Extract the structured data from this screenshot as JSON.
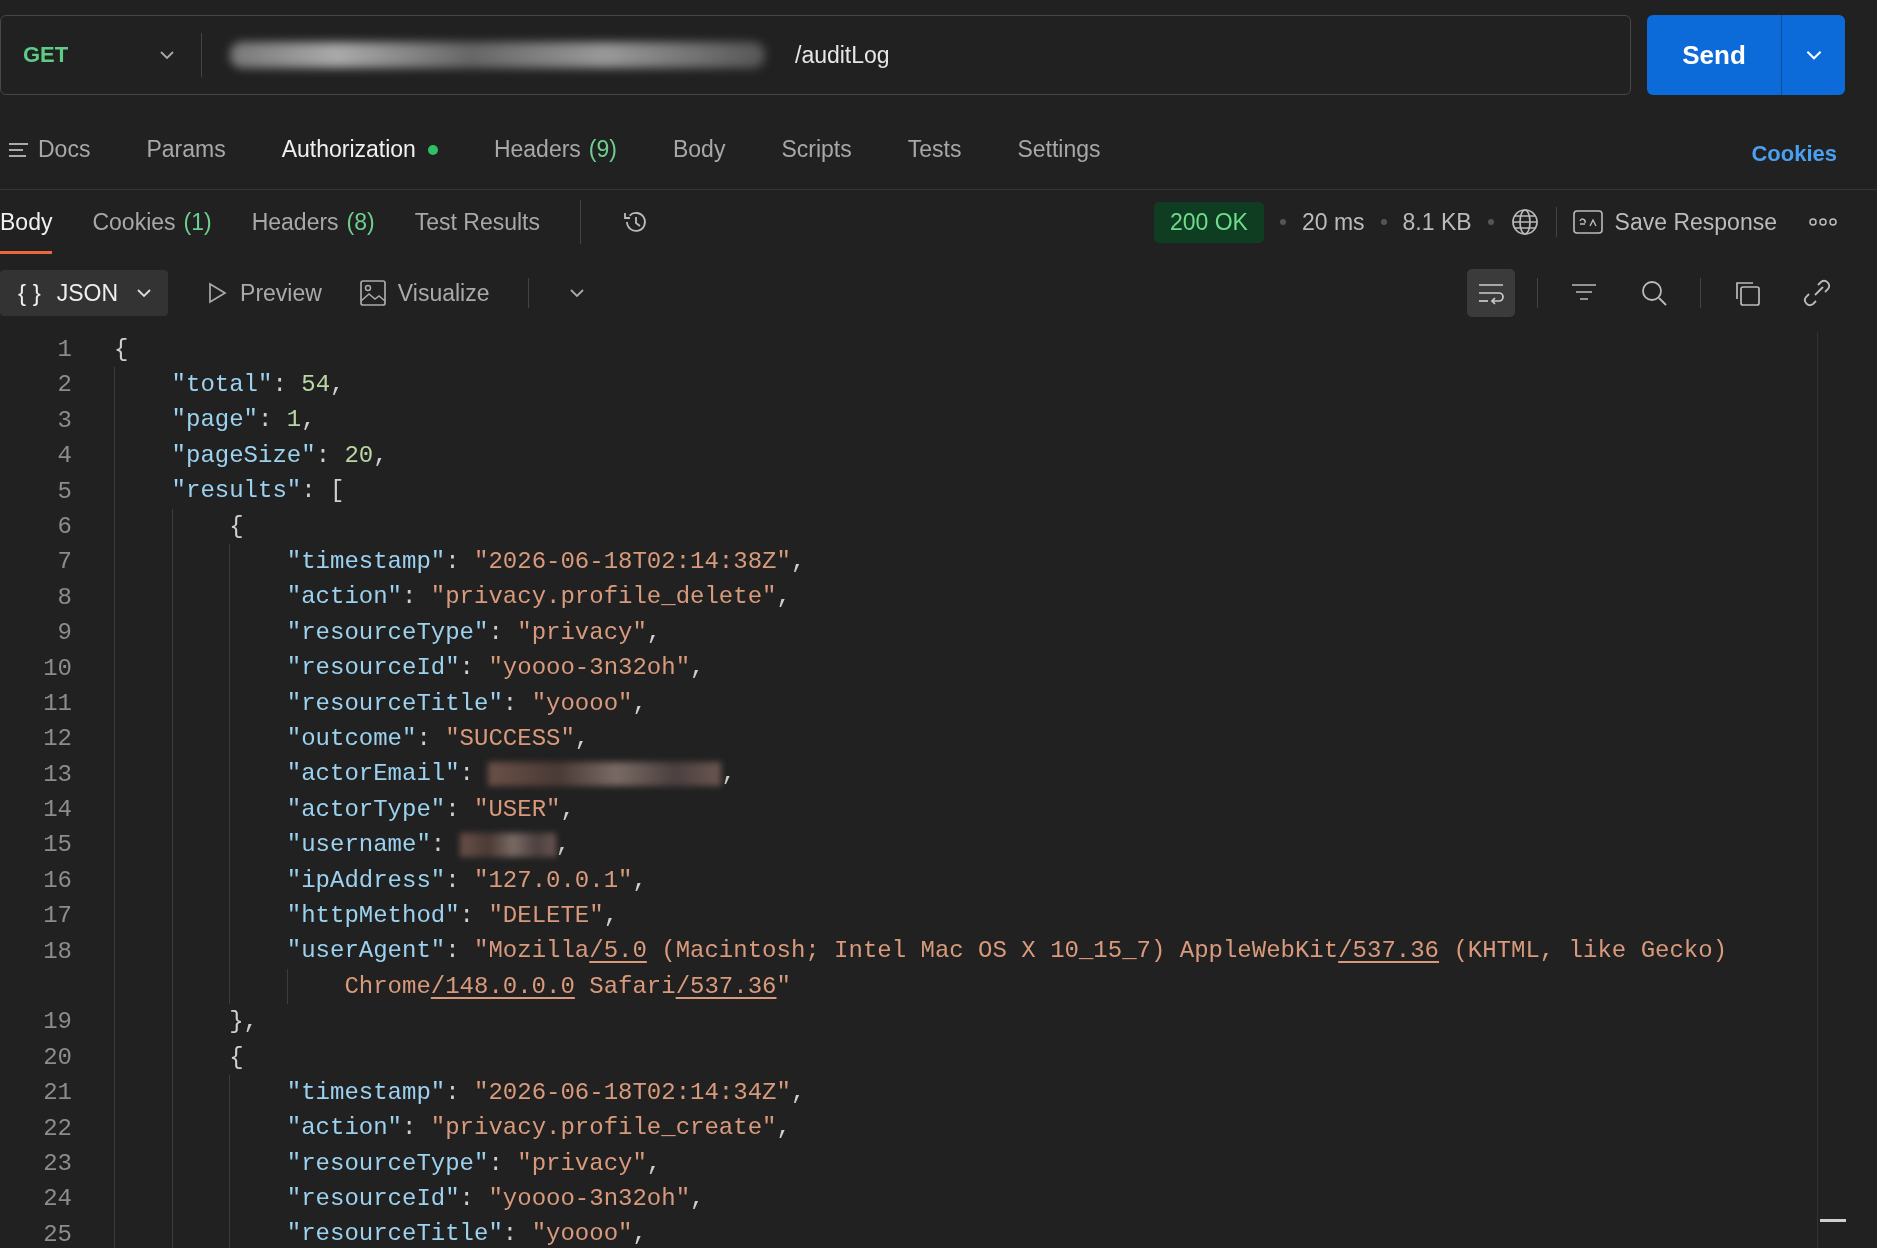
{
  "request": {
    "method": "GET",
    "url": {
      "redacted": true,
      "path": "/auditLog"
    },
    "send": "Send"
  },
  "request_tabs": [
    {
      "label": "Docs",
      "kind": "docs",
      "selected": false
    },
    {
      "label": "Params",
      "selected": false
    },
    {
      "label": "Authorization",
      "dot": true,
      "selected": true
    },
    {
      "label": "Headers",
      "count": "(9)",
      "selected": false
    },
    {
      "label": "Body",
      "selected": false
    },
    {
      "label": "Scripts",
      "selected": false
    },
    {
      "label": "Tests",
      "selected": false
    },
    {
      "label": "Settings",
      "selected": false
    }
  ],
  "cookies_link": "Cookies",
  "response": {
    "tabs": [
      {
        "label": "Body",
        "selected": true
      },
      {
        "label": "Cookies",
        "count": "(1)",
        "selected": false
      },
      {
        "label": "Headers",
        "count": "(8)",
        "selected": false
      },
      {
        "label": "Test Results",
        "selected": false
      }
    ],
    "status": "200 OK",
    "time": "20 ms",
    "size": "8.1 KB",
    "save_label": "Save Response",
    "format": {
      "glyph": "{ }",
      "label": "JSON"
    },
    "views": [
      {
        "label": "Preview",
        "kind": "preview"
      },
      {
        "label": "Visualize",
        "kind": "visualize"
      }
    ],
    "tools": [
      {
        "kind": "wrap",
        "selected": true
      },
      {
        "kind": "divider"
      },
      {
        "kind": "filter",
        "selected": false
      },
      {
        "kind": "search",
        "selected": false
      },
      {
        "kind": "divider"
      },
      {
        "kind": "copy",
        "selected": false
      },
      {
        "kind": "link",
        "selected": false
      }
    ],
    "lines": [
      {
        "n": "1",
        "tokens": [
          {
            "kind": "open",
            "text": "{"
          }
        ]
      },
      {
        "n": "2",
        "tokens": [
          {
            "kind": "key",
            "text": "\"total\""
          },
          {
            "kind": "punct",
            "text": ": "
          },
          {
            "kind": "number",
            "text": "54"
          },
          {
            "kind": "punct",
            "text": ","
          }
        ]
      },
      {
        "n": "3",
        "tokens": [
          {
            "kind": "key",
            "text": "\"page\""
          },
          {
            "kind": "punct",
            "text": ": "
          },
          {
            "kind": "number",
            "text": "1"
          },
          {
            "kind": "punct",
            "text": ","
          }
        ]
      },
      {
        "n": "4",
        "tokens": [
          {
            "kind": "key",
            "text": "\"pageSize\""
          },
          {
            "kind": "punct",
            "text": ": "
          },
          {
            "kind": "number",
            "text": "20"
          },
          {
            "kind": "punct",
            "text": ","
          }
        ]
      },
      {
        "n": "5",
        "tokens": [
          {
            "kind": "key",
            "text": "\"results\""
          },
          {
            "kind": "punct",
            "text": ": "
          },
          {
            "kind": "open",
            "text": "["
          }
        ]
      },
      {
        "n": "6",
        "tokens": [
          {
            "kind": "open",
            "text": "{"
          }
        ]
      },
      {
        "n": "7",
        "tokens": [
          {
            "kind": "key",
            "text": "\"timestamp\""
          },
          {
            "kind": "punct",
            "text": ": "
          },
          {
            "kind": "string",
            "text": "\"2026-06-18T02:14:38Z\""
          },
          {
            "kind": "punct",
            "text": ","
          }
        ]
      },
      {
        "n": "8",
        "tokens": [
          {
            "kind": "key",
            "text": "\"action\""
          },
          {
            "kind": "punct",
            "text": ": "
          },
          {
            "kind": "string",
            "text": "\"privacy.profile_delete\""
          },
          {
            "kind": "punct",
            "text": ","
          }
        ]
      },
      {
        "n": "9",
        "tokens": [
          {
            "kind": "key",
            "text": "\"resourceType\""
          },
          {
            "kind": "punct",
            "text": ": "
          },
          {
            "kind": "string",
            "text": "\"privacy\""
          },
          {
            "kind": "punct",
            "text": ","
          }
        ]
      },
      {
        "n": "10",
        "tokens": [
          {
            "kind": "key",
            "text": "\"resourceId\""
          },
          {
            "kind": "punct",
            "text": ": "
          },
          {
            "kind": "string",
            "text": "\"yoooo-3n32oh\""
          },
          {
            "kind": "punct",
            "text": ","
          }
        ]
      },
      {
        "n": "11",
        "tokens": [
          {
            "kind": "key",
            "text": "\"resourceTitle\""
          },
          {
            "kind": "punct",
            "text": ": "
          },
          {
            "kind": "string",
            "text": "\"yoooo\""
          },
          {
            "kind": "punct",
            "text": ","
          }
        ]
      },
      {
        "n": "12",
        "tokens": [
          {
            "kind": "key",
            "text": "\"outcome\""
          },
          {
            "kind": "punct",
            "text": ": "
          },
          {
            "kind": "string",
            "text": "\"SUCCESS\""
          },
          {
            "kind": "punct",
            "text": ","
          }
        ]
      },
      {
        "n": "13",
        "tokens": [
          {
            "kind": "key",
            "text": "\"actorEmail\""
          },
          {
            "kind": "punct",
            "text": ": "
          },
          {
            "kind": "redacted"
          },
          {
            "kind": "punct",
            "text": ","
          }
        ]
      },
      {
        "n": "14",
        "tokens": [
          {
            "kind": "key",
            "text": "\"actorType\""
          },
          {
            "kind": "punct",
            "text": ": "
          },
          {
            "kind": "string",
            "text": "\"USER\""
          },
          {
            "kind": "punct",
            "text": ","
          }
        ]
      },
      {
        "n": "15",
        "tokens": [
          {
            "kind": "key",
            "text": "\"username\""
          },
          {
            "kind": "punct",
            "text": ": "
          },
          {
            "kind": "redacted"
          },
          {
            "kind": "punct",
            "text": ","
          }
        ]
      },
      {
        "n": "16",
        "tokens": [
          {
            "kind": "key",
            "text": "\"ipAddress\""
          },
          {
            "kind": "punct",
            "text": ": "
          },
          {
            "kind": "string",
            "text": "\"127.0.0.1\""
          },
          {
            "kind": "punct",
            "text": ","
          }
        ]
      },
      {
        "n": "17",
        "tokens": [
          {
            "kind": "key",
            "text": "\"httpMethod\""
          },
          {
            "kind": "punct",
            "text": ": "
          },
          {
            "kind": "string",
            "text": "\"DELETE\""
          },
          {
            "kind": "punct",
            "text": ","
          }
        ]
      },
      {
        "n": "18",
        "tokens": [
          {
            "kind": "key",
            "text": "\"userAgent\""
          },
          {
            "kind": "punct",
            "text": ": "
          },
          {
            "kind": "string",
            "text": "\"Mozilla"
          },
          {
            "kind": "link",
            "text": "/5.0"
          },
          {
            "kind": "string",
            "text": " (Macintosh; Intel Mac OS X 10_15_7) AppleWebKit"
          },
          {
            "kind": "link",
            "text": "/537.36"
          },
          {
            "kind": "string",
            "text": " (KHTML, like Gecko)"
          }
        ],
        "wrapped": [
          {
            "kind": "string",
            "text": "Chrome"
          },
          {
            "kind": "link",
            "text": "/148.0.0.0"
          },
          {
            "kind": "string",
            "text": " Safari"
          },
          {
            "kind": "link",
            "text": "/537.36"
          },
          {
            "kind": "string",
            "text": "\""
          }
        ]
      },
      {
        "n": "19",
        "tokens": [
          {
            "kind": "close",
            "text": "}"
          },
          {
            "kind": "punct",
            "text": ","
          }
        ]
      },
      {
        "n": "20",
        "tokens": [
          {
            "kind": "open",
            "text": "{"
          }
        ]
      },
      {
        "n": "21",
        "tokens": [
          {
            "kind": "key",
            "text": "\"timestamp\""
          },
          {
            "kind": "punct",
            "text": ": "
          },
          {
            "kind": "string",
            "text": "\"2026-06-18T02:14:34Z\""
          },
          {
            "kind": "punct",
            "text": ","
          }
        ]
      },
      {
        "n": "22",
        "tokens": [
          {
            "kind": "key",
            "text": "\"action\""
          },
          {
            "kind": "punct",
            "text": ": "
          },
          {
            "kind": "string",
            "text": "\"privacy.profile_create\""
          },
          {
            "kind": "punct",
            "text": ","
          }
        ]
      },
      {
        "n": "23",
        "tokens": [
          {
            "kind": "key",
            "text": "\"resourceType\""
          },
          {
            "kind": "punct",
            "text": ": "
          },
          {
            "kind": "string",
            "text": "\"privacy\""
          },
          {
            "kind": "punct",
            "text": ","
          }
        ]
      },
      {
        "n": "24",
        "tokens": [
          {
            "kind": "key",
            "text": "\"resourceId\""
          },
          {
            "kind": "punct",
            "text": ": "
          },
          {
            "kind": "string",
            "text": "\"yoooo-3n32oh\""
          },
          {
            "kind": "punct",
            "text": ","
          }
        ]
      },
      {
        "n": "25",
        "tokens": [
          {
            "kind": "key",
            "text": "\"resourceTitle\""
          },
          {
            "kind": "punct",
            "text": ": "
          },
          {
            "kind": "string",
            "text": "\"yoooo\""
          },
          {
            "kind": "punct",
            "text": ","
          }
        ]
      }
    ]
  }
}
